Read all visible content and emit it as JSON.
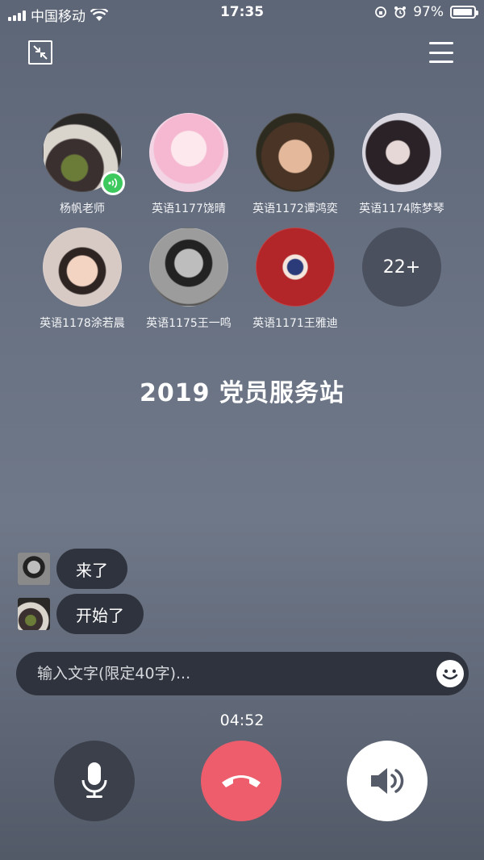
{
  "status_bar": {
    "carrier": "中国移动",
    "time": "17:35",
    "battery": "97%",
    "battery_level": 0.97
  },
  "participants": [
    {
      "name": "杨帆老师",
      "speaking": true
    },
    {
      "name": "英语1177饶晴"
    },
    {
      "name": "英语1172谭鸿奕"
    },
    {
      "name": "英语1174陈梦琴"
    },
    {
      "name": "英语1178涂若晨"
    },
    {
      "name": "英语1175王一鸣"
    },
    {
      "name": "英语1171王雅迪"
    }
  ],
  "more_count": "22+",
  "room_title": "2019 党员服务站",
  "messages": [
    {
      "text": "来了"
    },
    {
      "text": "开始了"
    }
  ],
  "input": {
    "placeholder": "输入文字(限定40字)...",
    "value": ""
  },
  "call_duration": "04:52",
  "colors": {
    "hangup": "#ee5d6c",
    "speaking": "#3dc95d"
  }
}
